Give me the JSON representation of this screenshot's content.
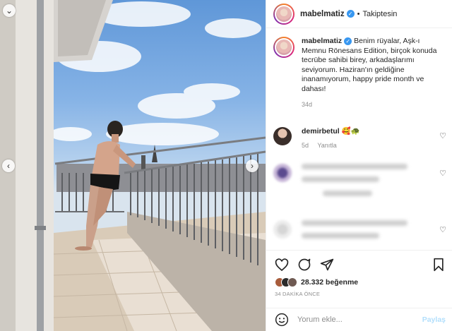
{
  "post": {
    "username": "mabelmatiz",
    "follow_status": "Takiptesin",
    "separator": "•",
    "caption": {
      "username": "mabelmatiz",
      "text": "Benim rüyalar, Aşk-ı Memnu Rönesans Edition, birçok konuda tecrübe sahibi birey, arkadaşlarımı seviyorum. Haziran'ın geldiğine inanamıyorum, happy pride month ve dahası!",
      "age": "34d"
    },
    "comments": [
      {
        "username": "demirbetul",
        "text": "🥰🐢",
        "age": "5d",
        "reply": "Yanıtla"
      }
    ],
    "likes": "28.332 beğenme",
    "timestamp": "34 DAKİKA ÖNCE",
    "comment_placeholder": "Yorum ekle...",
    "post_button": "Paylaş"
  },
  "icons": {
    "verified": "verified-badge-icon",
    "like": "heart-icon",
    "comment": "comment-icon",
    "share": "share-icon",
    "save": "bookmark-icon",
    "emoji": "emoji-icon",
    "carousel_prev": "chevron-left-icon",
    "carousel_next": "chevron-right-icon"
  },
  "colors": {
    "verified": "#3897f0",
    "post_button_disabled": "#b2dffc",
    "muted_text": "#8e8e8e"
  }
}
